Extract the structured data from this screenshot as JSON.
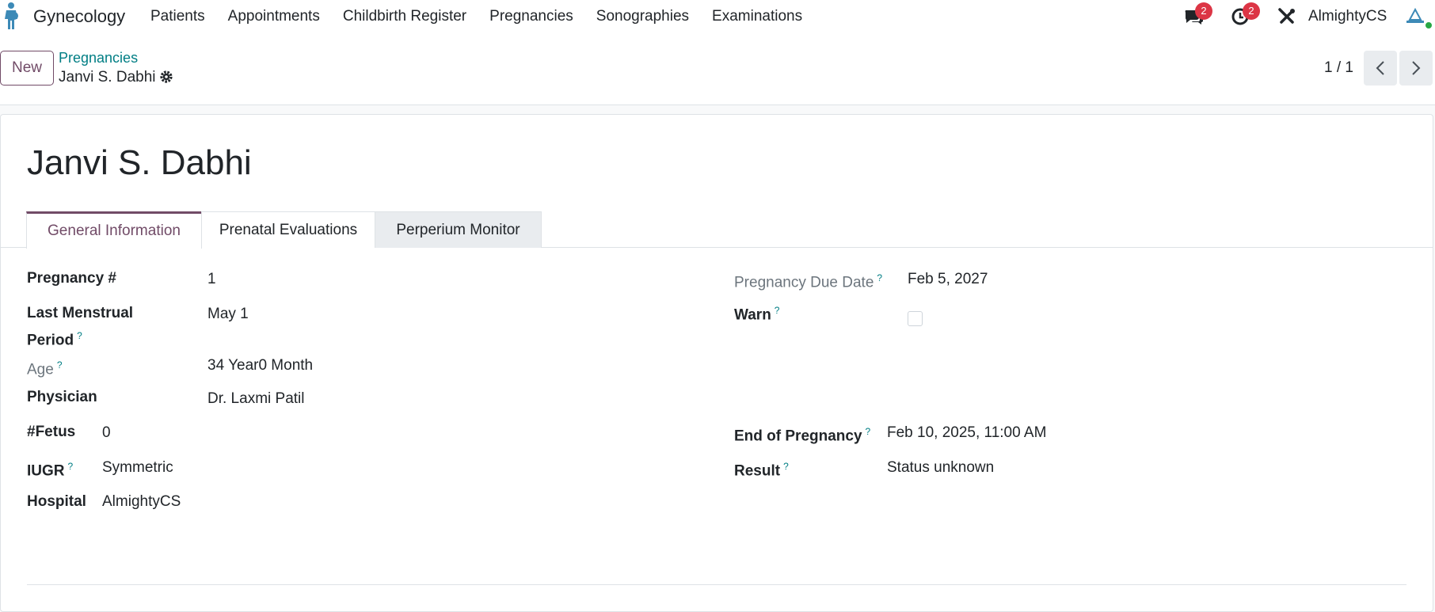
{
  "navbar": {
    "brand": "Gynecology",
    "menu": [
      "Patients",
      "Appointments",
      "Childbirth Register",
      "Pregnancies",
      "Sonographies",
      "Examinations"
    ],
    "messages_count": "2",
    "activities_count": "2",
    "company": "AlmightyCS"
  },
  "control": {
    "new_label": "New",
    "breadcrumb_parent": "Pregnancies",
    "breadcrumb_current": "Janvi S. Dabhi",
    "pager": "1 / 1"
  },
  "record": {
    "title": "Janvi S. Dabhi",
    "tabs": [
      "General Information",
      "Prenatal Evaluations",
      "Perperium Monitor"
    ],
    "fields": {
      "pregnancy_no": {
        "label": "Pregnancy #",
        "value": "1"
      },
      "lmp": {
        "label_1": "Last Menstrual",
        "label_2": "Period",
        "value": "May 1"
      },
      "age": {
        "label": "Age",
        "value": "34 Year0 Month"
      },
      "physician": {
        "label": "Physician",
        "value": "Dr. Laxmi Patil"
      },
      "fetus": {
        "label": "#Fetus",
        "value": "0"
      },
      "iugr": {
        "label": "IUGR",
        "value": "Symmetric"
      },
      "hospital": {
        "label": "Hospital",
        "value": "AlmightyCS"
      },
      "due_date": {
        "label": "Pregnancy Due Date",
        "value": "Feb 5, 2027"
      },
      "warn": {
        "label": "Warn",
        "checked": false
      },
      "end_of_pregnancy": {
        "label": "End of Pregnancy",
        "value": "Feb 10, 2025, 11:00 AM"
      },
      "result": {
        "label": "Result",
        "value": "Status unknown"
      }
    },
    "help_mark": "?"
  },
  "colors": {
    "accent": "#714b67",
    "link": "#017e84",
    "badge": "#dc3545"
  }
}
